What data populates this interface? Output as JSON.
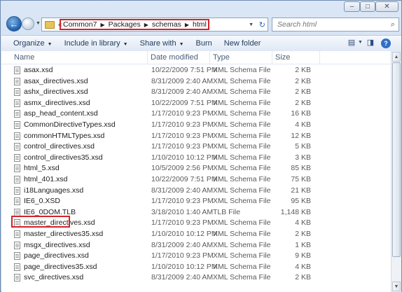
{
  "window": {
    "minimize": "–",
    "maximize": "□",
    "close": "✕"
  },
  "nav": {
    "back_icon": "back-arrow-icon",
    "overflow": "«",
    "breadcrumbs": [
      "Common7",
      "Packages",
      "schemas",
      "html"
    ],
    "refresh_icon": "refresh-icon"
  },
  "search": {
    "placeholder": "Search html"
  },
  "toolbar": {
    "organize": "Organize",
    "include_in_library": "Include in library",
    "share_with": "Share with",
    "burn": "Burn",
    "new_folder": "New folder",
    "help": "?"
  },
  "columns": {
    "name": "Name",
    "date_modified": "Date modified",
    "type": "Type",
    "size": "Size"
  },
  "files": [
    {
      "name": "asax.xsd",
      "date": "10/22/2009 7:51 PM",
      "type": "XML Schema File",
      "size": "2 KB"
    },
    {
      "name": "asax_directives.xsd",
      "date": "8/31/2009 2:40 AM",
      "type": "XML Schema File",
      "size": "2 KB"
    },
    {
      "name": "ashx_directives.xsd",
      "date": "8/31/2009 2:40 AM",
      "type": "XML Schema File",
      "size": "2 KB"
    },
    {
      "name": "asmx_directives.xsd",
      "date": "10/22/2009 7:51 PM",
      "type": "XML Schema File",
      "size": "2 KB"
    },
    {
      "name": "asp_head_content.xsd",
      "date": "1/17/2010 9:23 PM",
      "type": "XML Schema File",
      "size": "16 KB"
    },
    {
      "name": "CommonDirectiveTypes.xsd",
      "date": "1/17/2010 9:23 PM",
      "type": "XML Schema File",
      "size": "4 KB"
    },
    {
      "name": "commonHTMLTypes.xsd",
      "date": "1/17/2010 9:23 PM",
      "type": "XML Schema File",
      "size": "12 KB"
    },
    {
      "name": "control_directives.xsd",
      "date": "1/17/2010 9:23 PM",
      "type": "XML Schema File",
      "size": "5 KB"
    },
    {
      "name": "control_directives35.xsd",
      "date": "1/10/2010 10:12 PM",
      "type": "XML Schema File",
      "size": "3 KB"
    },
    {
      "name": "html_5.xsd",
      "date": "10/5/2009 2:56 PM",
      "type": "XML Schema File",
      "size": "85 KB"
    },
    {
      "name": "html_401.xsd",
      "date": "10/22/2009 7:51 PM",
      "type": "XML Schema File",
      "size": "75 KB"
    },
    {
      "name": "i18Languages.xsd",
      "date": "8/31/2009 2:40 AM",
      "type": "XML Schema File",
      "size": "21 KB"
    },
    {
      "name": "IE6_0.XSD",
      "date": "1/17/2010 9:23 PM",
      "type": "XML Schema File",
      "size": "95 KB"
    },
    {
      "name": "IE6_0DOM.TLB",
      "date": "3/18/2010 1:40 AM",
      "type": "TLB File",
      "size": "1,148 KB"
    },
    {
      "name": "master_directives.xsd",
      "date": "1/17/2010 9:23 PM",
      "type": "XML Schema File",
      "size": "4 KB"
    },
    {
      "name": "master_directives35.xsd",
      "date": "1/10/2010 10:12 PM",
      "type": "XML Schema File",
      "size": "2 KB"
    },
    {
      "name": "msgx_directives.xsd",
      "date": "8/31/2009 2:40 AM",
      "type": "XML Schema File",
      "size": "1 KB"
    },
    {
      "name": "page_directives.xsd",
      "date": "1/17/2010 9:23 PM",
      "type": "XML Schema File",
      "size": "9 KB"
    },
    {
      "name": "page_directives35.xsd",
      "date": "1/10/2010 10:12 PM",
      "type": "XML Schema File",
      "size": "4 KB"
    },
    {
      "name": "svc_directives.xsd",
      "date": "8/31/2009 2:40 AM",
      "type": "XML Schema File",
      "size": "2 KB"
    }
  ],
  "highlight_color": "#d2232a"
}
